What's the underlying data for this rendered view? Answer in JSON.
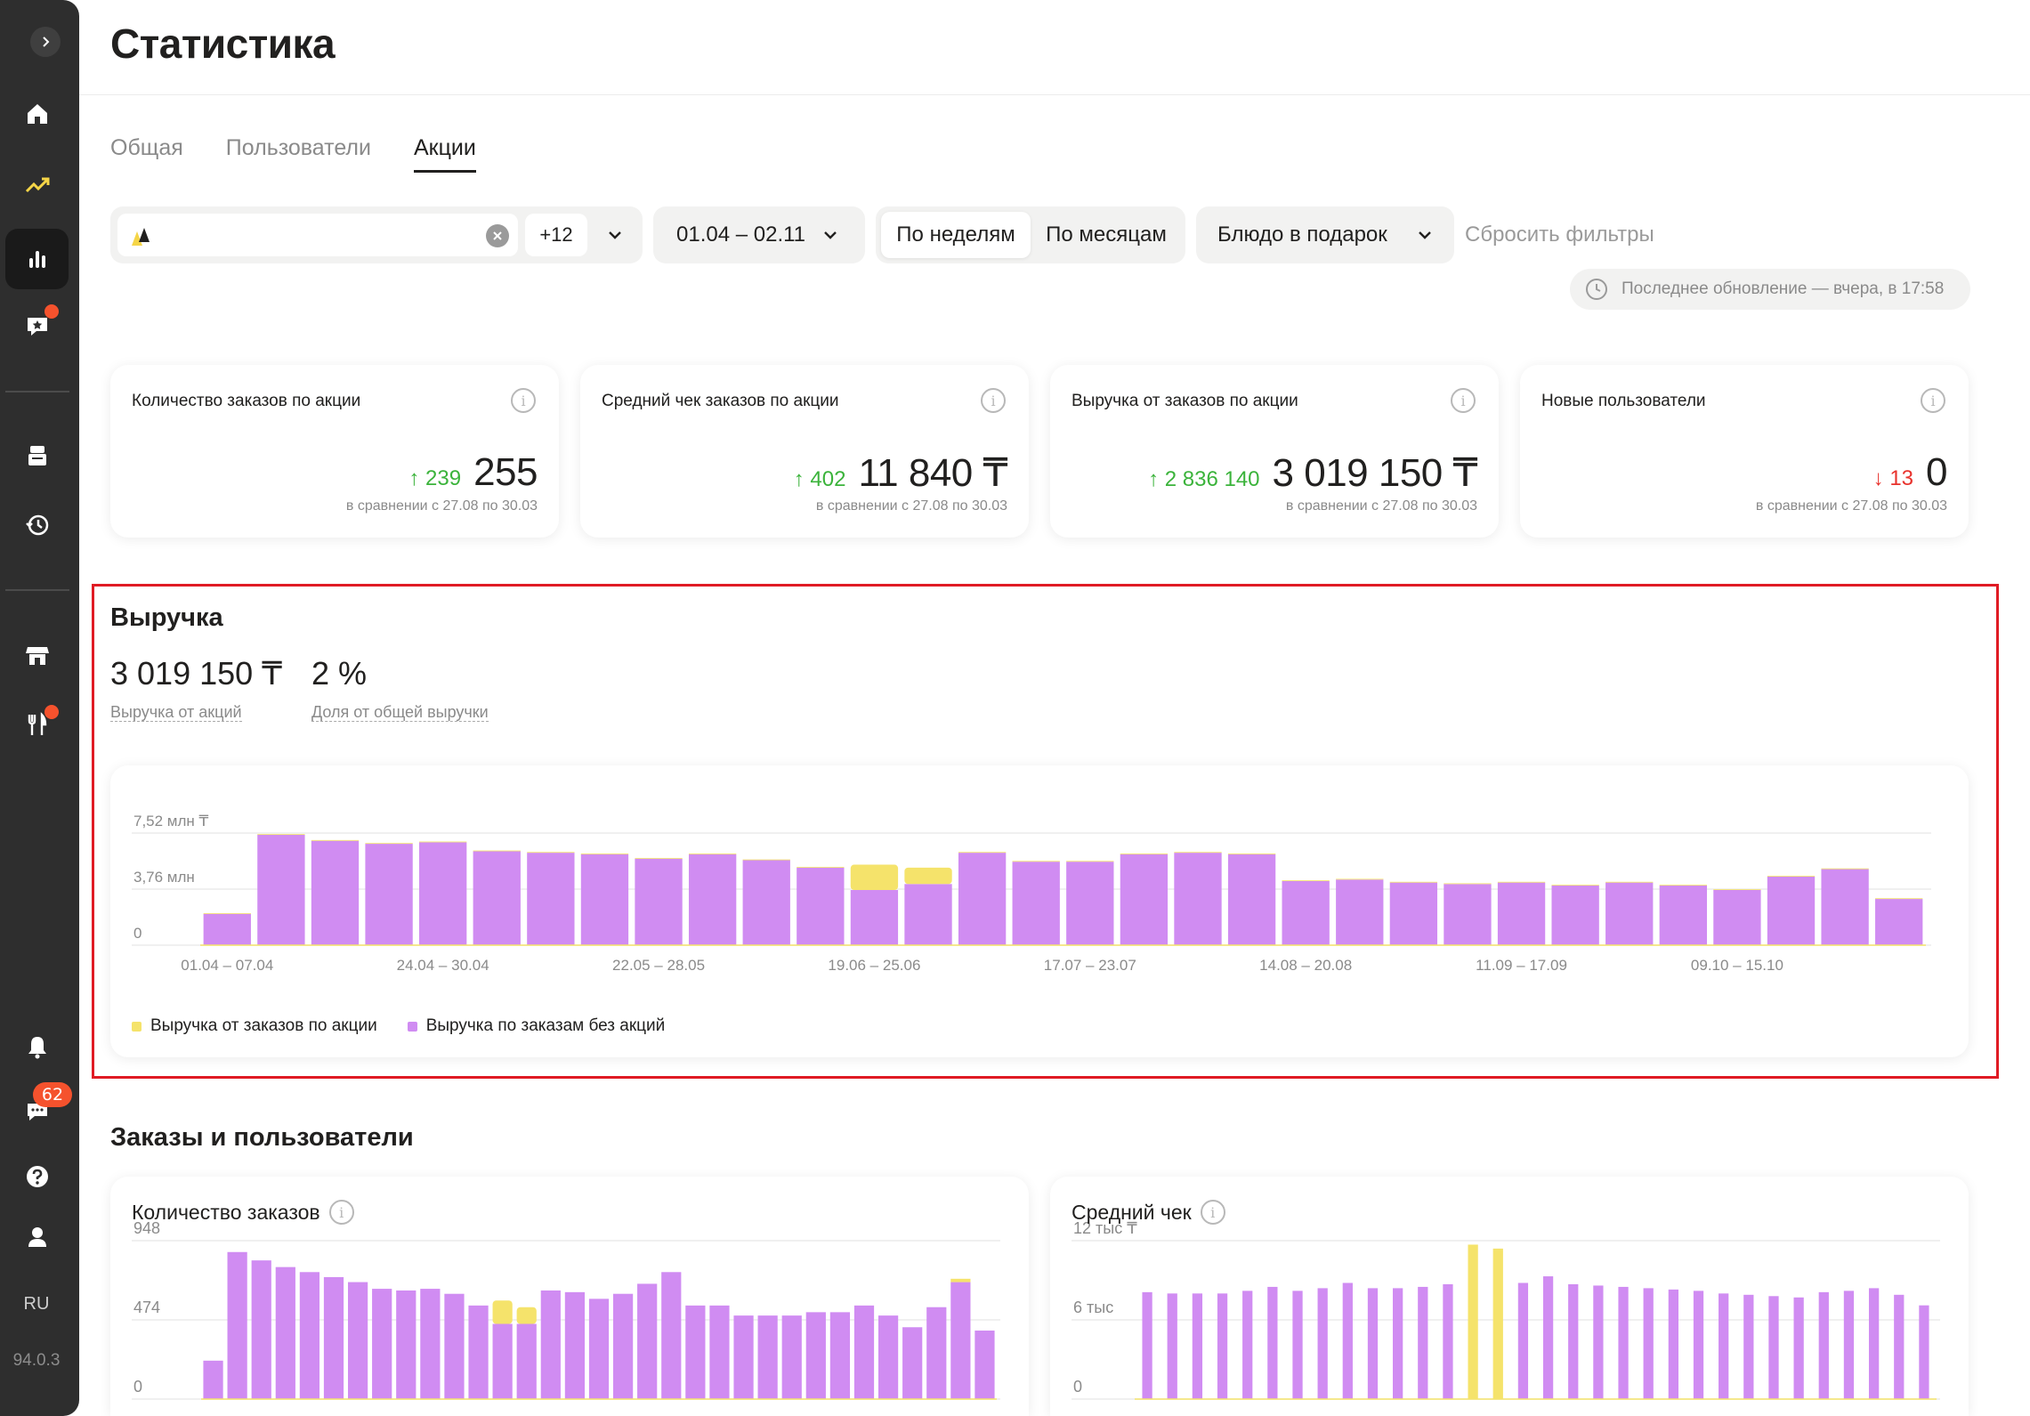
{
  "sidebar": {
    "badge_count": "62",
    "lang": "RU",
    "version": "94.0.3"
  },
  "header": {
    "title": "Статистика"
  },
  "tabs": [
    {
      "label": "Общая",
      "active": false
    },
    {
      "label": "Пользователи",
      "active": false
    },
    {
      "label": "Акции",
      "active": true
    }
  ],
  "filters": {
    "restaurant_extra": "+12",
    "date_range": "01.04 – 02.11",
    "period_options": [
      "По неделям",
      "По месяцам"
    ],
    "period_selected": "По неделям",
    "promo_type": "Блюдо в подарок",
    "reset_label": "Сбросить фильтры",
    "last_update": "Последнее обновление — вчера, в 17:58"
  },
  "kpis": [
    {
      "title": "Количество заказов по акции",
      "delta": "239",
      "direction": "up",
      "value": "255",
      "compare": "в сравнении с 27.08 по 30.03"
    },
    {
      "title": "Средний чек заказов по акции",
      "delta": "402",
      "direction": "up",
      "value": "11 840 ₸",
      "compare": "в сравнении с 27.08 по 30.03"
    },
    {
      "title": "Выручка от заказов по акции",
      "delta": "2 836 140",
      "direction": "up",
      "value": "3 019 150 ₸",
      "compare": "в сравнении с 27.08 по 30.03"
    },
    {
      "title": "Новые пользователи",
      "delta": "13",
      "direction": "down",
      "value": "0",
      "compare": "в сравнении с 27.08 по 30.03"
    }
  ],
  "revenue": {
    "title": "Выручка",
    "total_value": "3 019 150 ₸",
    "total_label": "Выручка от акций",
    "share_value": "2 %",
    "share_label": "Доля от общей выручки",
    "legend": {
      "promo": "Выручка от заказов по акции",
      "no_promo": "Выручка по заказам без акций"
    },
    "colors": {
      "promo": "#f5e36b",
      "no_promo": "#d08cf2"
    }
  },
  "orders_section": {
    "title": "Заказы и пользователи",
    "orders_card_title": "Количество заказов",
    "avg_check_card_title": "Средний чек"
  },
  "chart_data": [
    {
      "type": "bar",
      "stacked": true,
      "title": "Выручка",
      "y_ticks": [
        "0",
        "3,76 млн",
        "7,52 млн ₸"
      ],
      "ylim": [
        0,
        7.52
      ],
      "x_tick_labels": [
        "01.04 – 07.04",
        "24.04 – 30.04",
        "22.05 – 28.05",
        "19.06 – 25.06",
        "17.07 – 23.07",
        "14.08 – 20.08",
        "11.09 – 17.09",
        "09.10 – 15.10"
      ],
      "series": [
        {
          "name": "Выручка по заказам без акций",
          "values": [
            2.1,
            7.4,
            7.0,
            6.8,
            6.9,
            6.3,
            6.2,
            6.1,
            5.8,
            6.1,
            5.7,
            5.2,
            3.7,
            4.1,
            6.2,
            5.6,
            5.6,
            6.1,
            6.2,
            6.1,
            4.3,
            4.4,
            4.2,
            4.1,
            4.2,
            4.0,
            4.2,
            4.0,
            3.7,
            4.6,
            5.1,
            3.1
          ]
        },
        {
          "name": "Выручка от заказов по акции",
          "values": [
            0.05,
            0.05,
            0.05,
            0.05,
            0.05,
            0.05,
            0.05,
            0.05,
            0.05,
            0.05,
            0.05,
            0.05,
            1.7,
            1.1,
            0.05,
            0.05,
            0.05,
            0.05,
            0.05,
            0.05,
            0.05,
            0.05,
            0.05,
            0.05,
            0.05,
            0.05,
            0.05,
            0.05,
            0.05,
            0.05,
            0.05,
            0.05
          ]
        }
      ]
    },
    {
      "type": "bar",
      "stacked": true,
      "title": "Количество заказов",
      "y_ticks": [
        "0",
        "474",
        "948"
      ],
      "ylim": [
        0,
        948
      ],
      "series": [
        {
          "name": "Выручка по заказам без акций",
          "values": [
            230,
            880,
            830,
            790,
            760,
            730,
            700,
            660,
            650,
            660,
            630,
            560,
            450,
            450,
            650,
            640,
            600,
            630,
            690,
            760,
            560,
            560,
            500,
            500,
            500,
            520,
            520,
            560,
            500,
            430,
            550,
            700,
            410
          ]
        },
        {
          "name": "Выручка от заказов по акции",
          "values": [
            0,
            0,
            0,
            0,
            0,
            0,
            0,
            0,
            0,
            0,
            0,
            0,
            140,
            100,
            0,
            0,
            0,
            0,
            0,
            0,
            0,
            0,
            0,
            0,
            0,
            0,
            0,
            0,
            0,
            0,
            0,
            20,
            0
          ]
        }
      ]
    },
    {
      "type": "bar",
      "stacked": false,
      "title": "Средний чек",
      "y_ticks": [
        "0",
        "6 тыс",
        "12 тыс ₸"
      ],
      "ylim": [
        0,
        12
      ],
      "series": [
        {
          "name": "Выручка по заказам без акций",
          "values": [
            8.1,
            8.0,
            8.0,
            8.0,
            8.2,
            8.5,
            8.2,
            8.4,
            8.8,
            8.4,
            8.4,
            8.5,
            8.7,
            0,
            0,
            8.8,
            9.3,
            8.7,
            8.6,
            8.5,
            8.4,
            8.3,
            8.2,
            8.0,
            7.9,
            7.8,
            7.7,
            8.1,
            8.2,
            8.4,
            7.9,
            7.1
          ]
        },
        {
          "name": "Выручка от заказов по акции",
          "values": [
            0,
            0,
            0,
            0,
            0,
            0,
            0,
            0,
            0,
            0,
            0,
            0,
            0,
            11.7,
            11.4,
            0,
            0,
            0,
            0,
            0,
            0,
            0,
            0,
            0,
            0,
            0,
            0,
            0,
            0,
            0,
            0,
            0
          ]
        }
      ]
    }
  ]
}
